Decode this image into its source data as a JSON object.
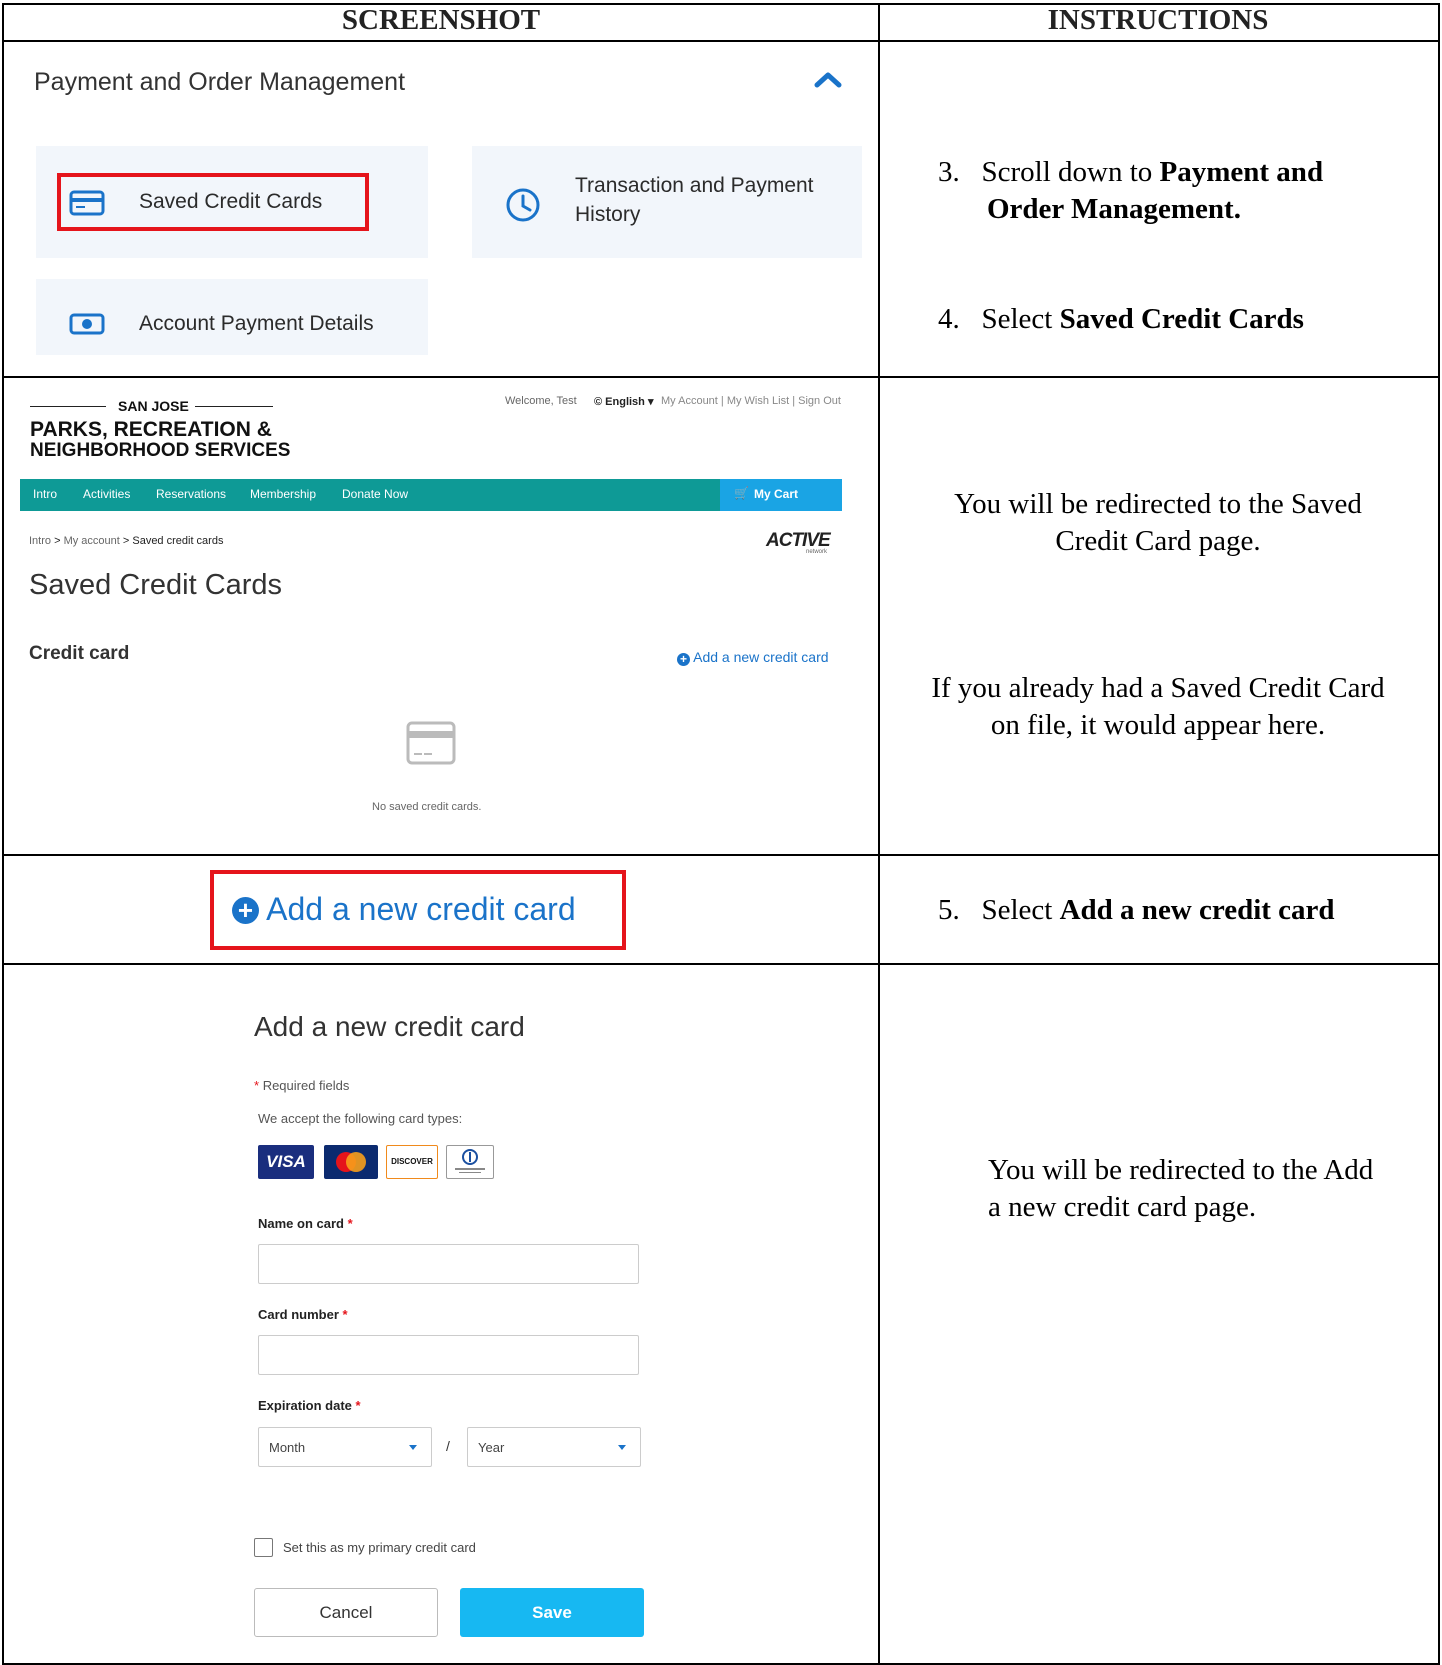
{
  "headers": {
    "screenshot": "SCREENSHOT",
    "instructions": "INSTRUCTIONS"
  },
  "payment_section": {
    "title": "Payment and Order Management",
    "tiles": {
      "saved_cards": "Saved Credit Cards",
      "transaction_line1": "Transaction and Payment",
      "transaction_line2": "History",
      "account_payment": "Account Payment Details"
    }
  },
  "steps": {
    "s3_num": "3.",
    "s3_pre": "Scroll down to ",
    "s3_bold1": "Payment and",
    "s3_bold2": "Order Management.",
    "s4_num": "4.",
    "s4_pre": "Select ",
    "s4_bold": "Saved Credit Cards",
    "redirect1_line1": "You will be redirected to the Saved",
    "redirect1_line2": "Credit Card page.",
    "already_line1": "If you already had a Saved Credit Card",
    "already_line2": "on file, it would appear here.",
    "s5_num": "5.",
    "s5_pre": "Select ",
    "s5_bold": "Add a new credit card",
    "redirect2_line1": "You will be redirected to the Add",
    "redirect2_line2": "a new credit card page."
  },
  "site": {
    "city": "SAN JOSE",
    "org_line1": "PARKS, RECREATION &",
    "org_line2": "NEIGHBORHOOD SERVICES",
    "welcome": "Welcome, Test",
    "language": "English",
    "account_links": "My Account  |  My Wish List  |  Sign Out",
    "nav": [
      "Intro",
      "Activities",
      "Reservations",
      "Membership",
      "Donate Now"
    ],
    "cart": "My Cart",
    "breadcrumb": [
      "Intro",
      "My account",
      "Saved credit cards"
    ],
    "brand": "ACTIVE",
    "brand_sub": "network",
    "page_title": "Saved Credit Cards",
    "section_label": "Credit card",
    "add_link": "Add a new credit card",
    "empty_text": "No saved credit cards."
  },
  "add_button_zoom": "Add a new credit card",
  "form": {
    "title": "Add a new credit card",
    "required_note": "Required fields",
    "accept_note": "We accept the following card types:",
    "card_types": [
      "VISA",
      "mastercard",
      "DISCOVER",
      "Diners Club INTERNATIONAL"
    ],
    "name_label": "Name on card",
    "number_label": "Card number",
    "exp_label": "Expiration date",
    "month_placeholder": "Month",
    "year_placeholder": "Year",
    "slash": "/",
    "primary_label": "Set this as my primary credit card",
    "cancel": "Cancel",
    "save": "Save"
  },
  "colors": {
    "accent_red": "#e5141b",
    "nav_teal": "#0e9a96",
    "link_blue": "#1a73c9",
    "save_blue": "#17b8f2"
  }
}
